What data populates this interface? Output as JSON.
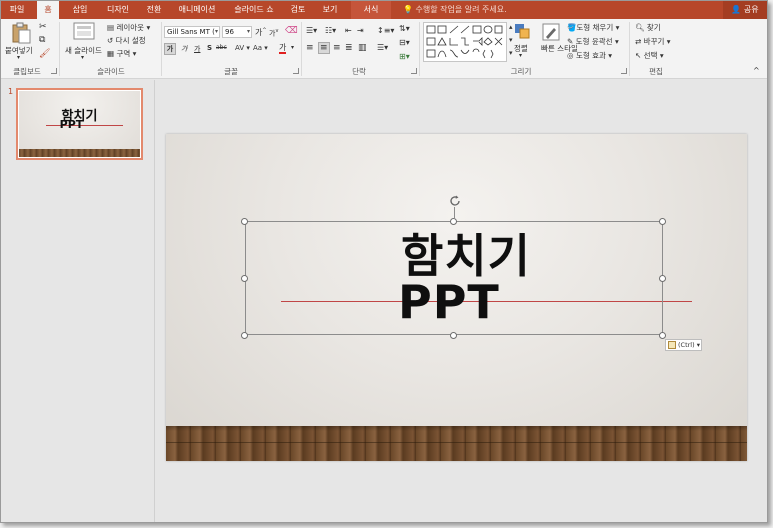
{
  "tabs": [
    {
      "label": "파일",
      "active": false
    },
    {
      "label": "홈",
      "active": true
    },
    {
      "label": "삽입",
      "active": false
    },
    {
      "label": "디자인",
      "active": false
    },
    {
      "label": "전환",
      "active": false
    },
    {
      "label": "애니메이션",
      "active": false
    },
    {
      "label": "슬라이드 쇼",
      "active": false
    },
    {
      "label": "검토",
      "active": false
    },
    {
      "label": "보기",
      "active": false
    },
    {
      "label": "서식",
      "active": false
    }
  ],
  "tell_me": "수행할 작업을 알려 주세요.",
  "share": "공유",
  "ribbon": {
    "clipboard": {
      "label": "클립보드",
      "paste": "붙여넣기"
    },
    "slides": {
      "label": "슬라이드",
      "new_slide": "새 슬라이드",
      "layout": "레이아웃",
      "reset": "다시 설정",
      "section": "구역"
    },
    "font": {
      "label": "글꼴",
      "font_name": "Gill Sans MT (",
      "font_size": "96",
      "bold": "가",
      "italic": "가",
      "underline": "가",
      "strike": "S",
      "shadow": "abc",
      "change_case": "Aa",
      "font_color": "가",
      "grow": "가",
      "shrink": "가"
    },
    "paragraph": {
      "label": "단락"
    },
    "drawing": {
      "label": "그리기",
      "arrange": "정렬",
      "quick_styles": "빠른 스타일",
      "fill": "도형 채우기",
      "outline": "도형 윤곽선",
      "effects": "도형 효과"
    },
    "editing": {
      "label": "편집",
      "find": "찾기",
      "replace": "바꾸기",
      "select": "선택"
    }
  },
  "thumbnail": {
    "number": "1",
    "title1": "함치기",
    "title2": "PPT"
  },
  "slide": {
    "title1": "함치기",
    "title2": "PPT"
  },
  "paste_options": "(Ctrl)",
  "colors": {
    "accent": "#b7472a",
    "line": "#c04646"
  }
}
